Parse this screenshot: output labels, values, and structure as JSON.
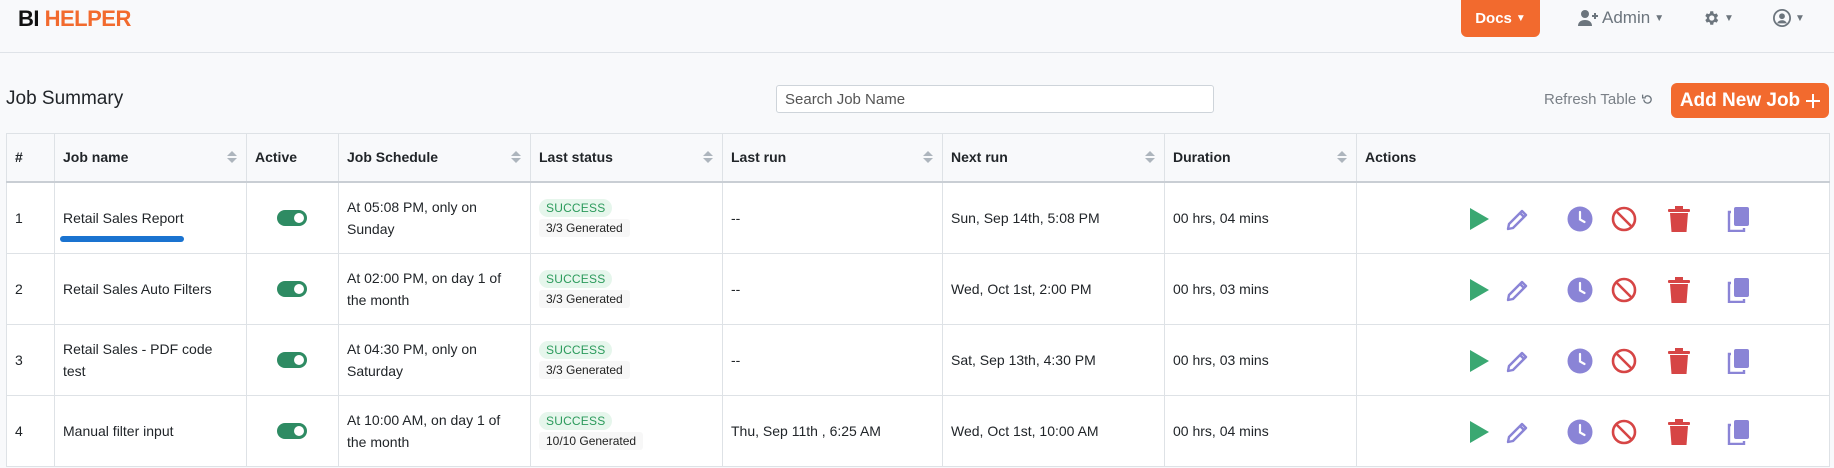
{
  "navbar": {
    "logo_bi": "BI",
    "logo_helper": "HELPER",
    "docs_label": "Docs",
    "admin_label": "Admin",
    "icons": [
      "add-user-icon",
      "gear-icon",
      "user-circle-icon"
    ]
  },
  "toolbar": {
    "title": "Job Summary",
    "search_placeholder": "Search Job Name",
    "refresh_label": "Refresh Table",
    "add_label": "Add New Job"
  },
  "table": {
    "columns": [
      "#",
      "Job name",
      "Active",
      "Job Schedule",
      "Last status",
      "Last run",
      "Next run",
      "Duration",
      "Actions"
    ],
    "rows": [
      {
        "num": "1",
        "name": "Retail Sales Report",
        "active": true,
        "schedule": "At 05:08 PM, only on Sunday",
        "status": "SUCCESS",
        "generated": "3/3 Generated",
        "last_run": "--",
        "next_run": "Sun, Sep 14th, 5:08 PM",
        "duration": "00 hrs, 04 mins"
      },
      {
        "num": "2",
        "name": "Retail Sales Auto Filters",
        "active": true,
        "schedule": "At 02:00 PM, on day 1 of the month",
        "status": "SUCCESS",
        "generated": "3/3 Generated",
        "last_run": "--",
        "next_run": "Wed, Oct 1st, 2:00 PM",
        "duration": "00 hrs, 03 mins"
      },
      {
        "num": "3",
        "name": "Retail Sales - PDF code test",
        "active": true,
        "schedule": "At 04:30 PM, only on Saturday",
        "status": "SUCCESS",
        "generated": "3/3 Generated",
        "last_run": "--",
        "next_run": "Sat, Sep 13th, 4:30 PM",
        "duration": "00 hrs, 03 mins"
      },
      {
        "num": "4",
        "name": "Manual filter input",
        "active": true,
        "schedule": "At 10:00 AM, on day 1 of the month",
        "status": "SUCCESS",
        "generated": "10/10 Generated",
        "last_run": "Thu, Sep 11th , 6:25 AM",
        "next_run": "Wed, Oct 1st, 10:00 AM",
        "duration": "00 hrs, 04 mins"
      }
    ],
    "action_icons": [
      "play-icon",
      "edit-icon",
      "clock-icon",
      "block-icon",
      "trash-icon",
      "copy-icon"
    ]
  },
  "colors": {
    "brand_orange": "#f26a2e",
    "success_green": "#2b9a5b",
    "play_green": "#3aa872",
    "edit_purple": "#8a84d6",
    "block_red": "#d64545",
    "highlight_blue": "#1a73d0"
  }
}
